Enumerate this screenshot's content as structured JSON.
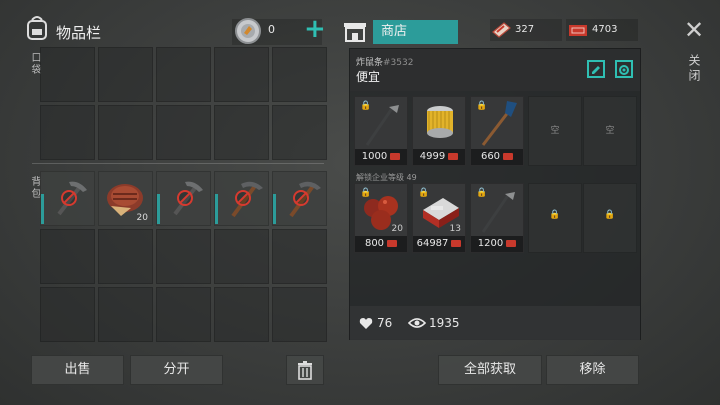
{
  "inventory": {
    "title": "物品栏",
    "coins": "0",
    "pockets_label": "口袋",
    "backpack_label": "背包",
    "backpack_items": [
      {
        "name": "pickaxe",
        "qty": "",
        "icon": "pickaxe-icon"
      },
      {
        "name": "steak",
        "qty": "20",
        "icon": "steak-icon"
      },
      {
        "name": "pickaxe",
        "qty": "",
        "icon": "pickaxe-icon"
      },
      {
        "name": "wooden pickaxe",
        "qty": "",
        "icon": "wooden-pickaxe-icon"
      },
      {
        "name": "wooden pickaxe",
        "qty": "",
        "icon": "wooden-pickaxe-icon"
      }
    ],
    "buttons": {
      "sell": "出售",
      "split": "分开"
    }
  },
  "shop": {
    "tab_label": "商店",
    "currency_a": "327",
    "currency_b": "4703",
    "seller": "炸鼠条",
    "seller_id": "#3532",
    "name": "便宜",
    "empty_label": "空",
    "unlock_text": "解锁企业等级 49",
    "row1": [
      {
        "icon": "hoe-icon",
        "price": "1000",
        "qty": "",
        "locked": true
      },
      {
        "icon": "oil-filter-icon",
        "price": "4999",
        "qty": "",
        "locked": false
      },
      {
        "icon": "oar-icon",
        "price": "660",
        "qty": "",
        "locked": true
      }
    ],
    "row2": [
      {
        "icon": "tomatoes-icon",
        "price": "800",
        "qty": "20",
        "locked": true
      },
      {
        "icon": "cigarettes-icon",
        "price": "64987",
        "qty": "13",
        "locked": true
      },
      {
        "icon": "hoe-icon",
        "price": "1200",
        "qty": "",
        "locked": true
      }
    ],
    "likes": "76",
    "views": "1935",
    "buttons": {
      "take_all": "全部获取",
      "remove": "移除"
    }
  },
  "close": {
    "label": "关闭"
  },
  "colors": {
    "accent": "#2c9c9a",
    "danger": "#d63a2f",
    "tag": "#c8392c"
  }
}
